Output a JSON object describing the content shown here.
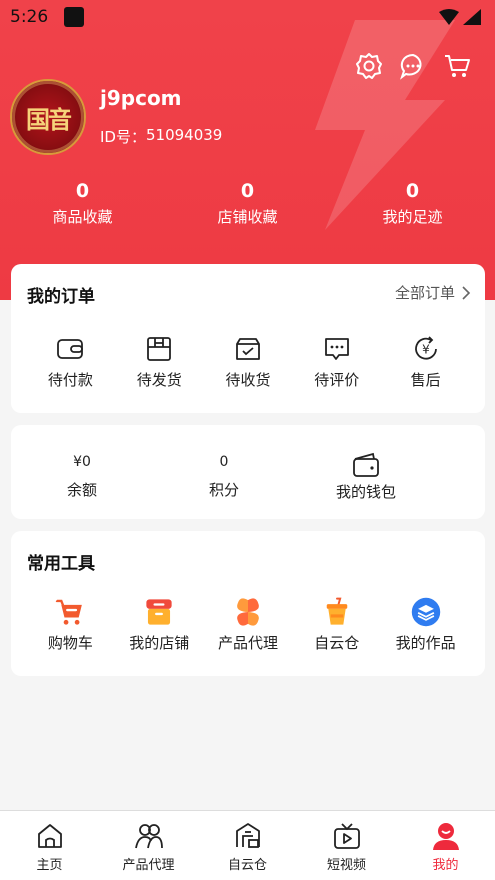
{
  "status_bar": {
    "time": "5:26"
  },
  "header": {
    "username": "j9pcom",
    "id_label": "ID号：",
    "id_value": "51094039",
    "avatar_text": "国音",
    "stats": [
      {
        "value": "0",
        "label": "商品收藏"
      },
      {
        "value": "0",
        "label": "店铺收藏"
      },
      {
        "value": "0",
        "label": "我的足迹"
      }
    ]
  },
  "orders": {
    "title": "我的订单",
    "more_label": "全部订单",
    "items": [
      {
        "label": "待付款",
        "icon": "wallet-icon"
      },
      {
        "label": "待发货",
        "icon": "package-icon"
      },
      {
        "label": "待收货",
        "icon": "inbox-check-icon"
      },
      {
        "label": "待评价",
        "icon": "comment-icon"
      },
      {
        "label": "售后",
        "icon": "refund-icon"
      }
    ]
  },
  "wallet": {
    "items": [
      {
        "value": "¥0",
        "label": "余额"
      },
      {
        "value": "0",
        "label": "积分"
      },
      {
        "label": "我的钱包",
        "icon": "wallet-icon"
      }
    ]
  },
  "tools": {
    "title": "常用工具",
    "items": [
      {
        "label": "购物车",
        "icon": "cart-icon"
      },
      {
        "label": "我的店铺",
        "icon": "store-icon"
      },
      {
        "label": "产品代理",
        "icon": "clover-icon"
      },
      {
        "label": "自云仓",
        "icon": "cup-icon"
      },
      {
        "label": "我的作品",
        "icon": "layers-icon"
      }
    ]
  },
  "tabbar": {
    "items": [
      {
        "label": "主页",
        "icon": "home-icon"
      },
      {
        "label": "产品代理",
        "icon": "people-icon"
      },
      {
        "label": "自云仓",
        "icon": "warehouse-icon"
      },
      {
        "label": "短视频",
        "icon": "tv-icon"
      },
      {
        "label": "我的",
        "icon": "profile-icon",
        "active": true
      }
    ]
  },
  "colors": {
    "accent": "#ee3a43",
    "active_tab": "#ee2a3c"
  }
}
